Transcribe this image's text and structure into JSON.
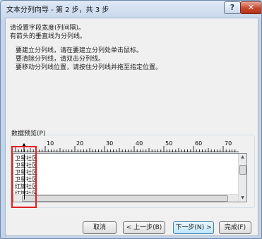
{
  "window": {
    "title": "文本分列向导 - 第 2 步，共 3 步",
    "help_label": "?",
    "close_label": "✕"
  },
  "instructions": {
    "line1": "请设置字段宽度(列间隔)。",
    "line2": "有箭头的垂直线为分列线。",
    "tip1": "要建立分列线，请在要建立分列处单击鼠标。",
    "tip2": "要清除分列线，请双击分列线。",
    "tip3": "要移动分列线位置，请按住分列线并拖至指定位置。"
  },
  "preview": {
    "label": "数据预览(P)",
    "ruler_ticks": [
      "10",
      "20",
      "30",
      "40",
      "50",
      "60",
      "70"
    ],
    "rows": [
      "卫星社区",
      "卫星社区",
      "卫星社区",
      "卫星社区",
      "红旗社区",
      "红旗社区"
    ]
  },
  "buttons": {
    "cancel": "取消",
    "back": "< 上一步(B)",
    "next": "下一步(N) >",
    "finish": "完成(F)"
  },
  "colors": {
    "highlight": "#e02020",
    "title_bg": "#c3d4ea"
  }
}
